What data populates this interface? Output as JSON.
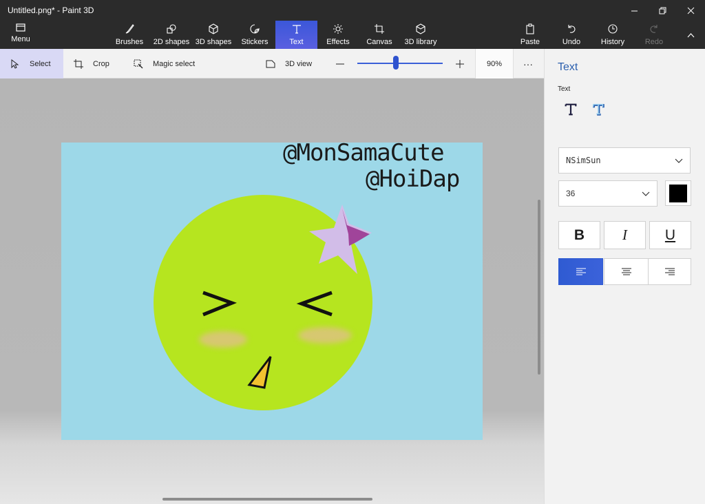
{
  "window": {
    "title": "Untitled.png* - Paint 3D"
  },
  "toolbar": {
    "menu": "Menu",
    "brushes": "Brushes",
    "shapes2d": "2D shapes",
    "shapes3d": "3D shapes",
    "stickers": "Stickers",
    "text": "Text",
    "effects": "Effects",
    "canvas": "Canvas",
    "library3d": "3D library",
    "paste": "Paste",
    "undo": "Undo",
    "history": "History",
    "redo": "Redo"
  },
  "subtoolbar": {
    "select": "Select",
    "crop": "Crop",
    "magic_select": "Magic select",
    "view3d": "3D view",
    "zoom": "90%",
    "zoom_value": 0.45,
    "more": "···"
  },
  "canvas": {
    "text1": "@MonSamaCute",
    "text2": "@HoiDap",
    "left_eye": ">",
    "right_eye": "<"
  },
  "panel": {
    "title": "Text",
    "subtitle": "Text",
    "font": "NSimSun",
    "size": "36",
    "bold": "B",
    "italic": "I",
    "underline": "U",
    "color": "#000000"
  },
  "colors": {
    "accent": "#3b57d9",
    "canvas_bg": "#9dd8e8",
    "face": "#b6e51f",
    "star": "#d2bde8",
    "star_shadow": "#a0449a",
    "beak": "#f2c230"
  }
}
